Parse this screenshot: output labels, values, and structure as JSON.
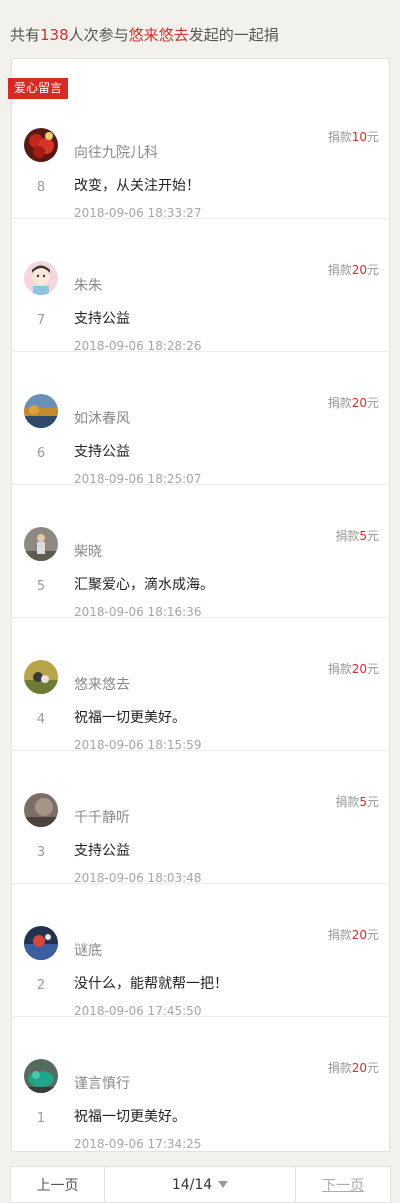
{
  "summary": {
    "prefix": "共有",
    "count": "138",
    "middle": "人次参与",
    "initiator": "悠来悠去",
    "suffix": "发起的一起捐"
  },
  "tag_label": "爱心留言",
  "amount_prefix": "捐款",
  "amount_unit": "元",
  "entries": [
    {
      "rank": "8",
      "name": "向往九院儿科",
      "amount": "10",
      "message": "改变，从关注开始！",
      "time": "2018-09-06 18:33:27"
    },
    {
      "rank": "7",
      "name": "朱朱",
      "amount": "20",
      "message": "支持公益",
      "time": "2018-09-06 18:28:26"
    },
    {
      "rank": "6",
      "name": "如沐春风",
      "amount": "20",
      "message": "支持公益",
      "time": "2018-09-06 18:25:07"
    },
    {
      "rank": "5",
      "name": "柴晓",
      "amount": "5",
      "message": "汇聚爱心，滴水成海。",
      "time": "2018-09-06 18:16:36"
    },
    {
      "rank": "4",
      "name": "悠来悠去",
      "amount": "20",
      "message": "祝福一切更美好。",
      "time": "2018-09-06 18:15:59"
    },
    {
      "rank": "3",
      "name": "千千静听",
      "amount": "5",
      "message": "支持公益",
      "time": "2018-09-06 18:03:48"
    },
    {
      "rank": "2",
      "name": "谜底",
      "amount": "20",
      "message": "没什么，能帮就帮一把！",
      "time": "2018-09-06 17:45:50"
    },
    {
      "rank": "1",
      "name": "谨言慎行",
      "amount": "20",
      "message": "祝福一切更美好。",
      "time": "2018-09-06 17:34:25"
    }
  ],
  "pager": {
    "prev_label": "上一页",
    "page_indicator": "14/14",
    "next_label": "下一页"
  },
  "colors": {
    "accent": "#d0312d",
    "tag_bg": "#d52b24",
    "page_bg": "#f3f1ec"
  }
}
